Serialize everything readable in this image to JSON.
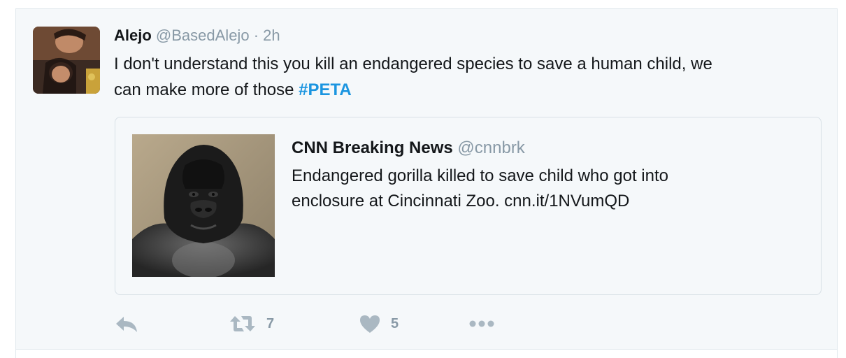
{
  "tweet": {
    "display_name": "Alejo",
    "handle": "@BasedAlejo",
    "separator": "·",
    "timestamp": "2h",
    "text_line1": "I don't understand this you kill an endangered species to save a human child, we",
    "text_line2": "can make more of those",
    "hashtag": "#PETA"
  },
  "quote": {
    "display_name": "CNN Breaking News",
    "handle": "@cnnbrk",
    "text_line1": "Endangered gorilla killed to save child who got into",
    "text_line2": "enclosure at Cincinnati Zoo. cnn.it/1NVumQD"
  },
  "actions": {
    "reply_icon": "reply-icon",
    "retweet_icon": "retweet-icon",
    "retweet_count": "7",
    "like_icon": "heart-icon",
    "like_count": "5",
    "more_icon": "more-icon"
  },
  "colors": {
    "background": "#f5f8fa",
    "text": "#14171a",
    "secondary": "#8899a6",
    "hashtag": "#1b95e0",
    "border": "#e1e8ed"
  }
}
